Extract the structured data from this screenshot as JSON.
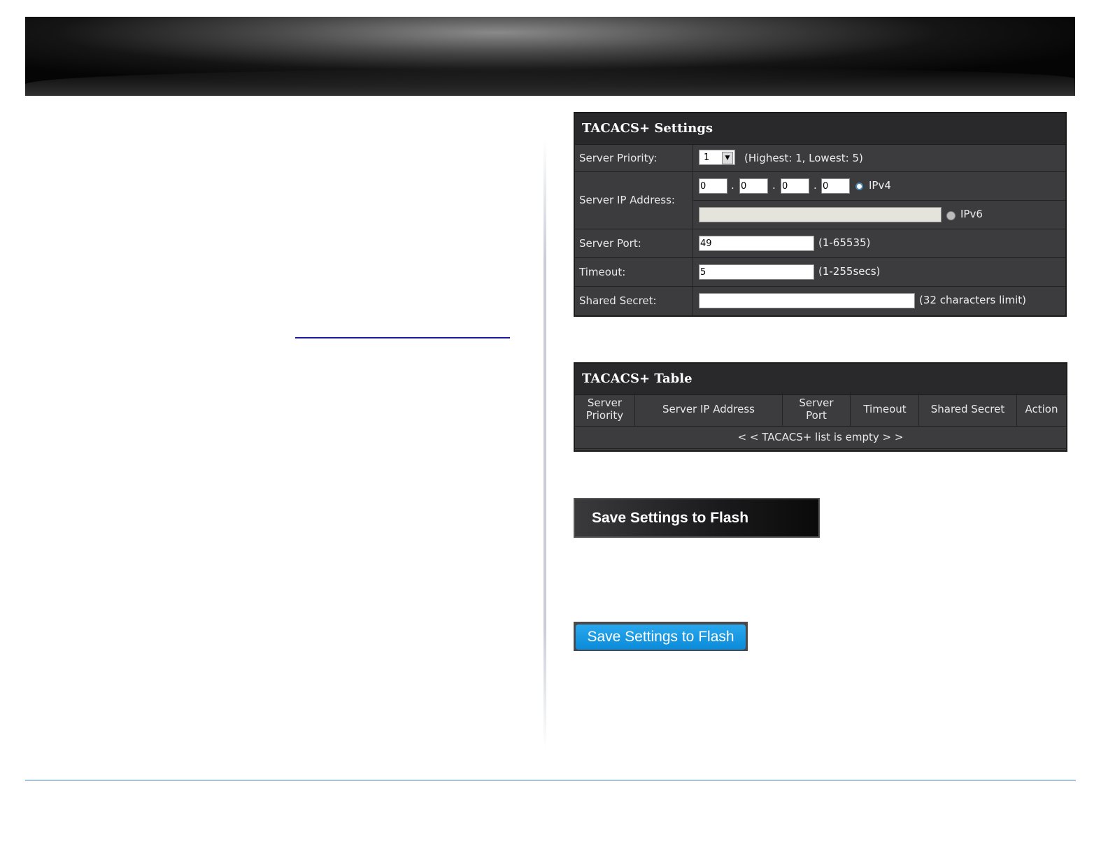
{
  "settings": {
    "title": "TACACS+ Settings",
    "priority_label": "Server Priority:",
    "priority_value": "1",
    "priority_note": "(Highest: 1, Lowest: 5)",
    "ip_label": "Server IP Address:",
    "ip_octets": [
      "0",
      "0",
      "0",
      "0"
    ],
    "ipv4_label": "IPv4",
    "ipv6_label": "IPv6",
    "ipv6_value": "",
    "ip_mode": "IPv4",
    "port_label": "Server Port:",
    "port_value": "49",
    "port_note": "(1-65535)",
    "timeout_label": "Timeout:",
    "timeout_value": "5",
    "timeout_note": "(1-255secs)",
    "secret_label": "Shared Secret:",
    "secret_value": "",
    "secret_note": "(32 characters limit)"
  },
  "table": {
    "title": "TACACS+ Table",
    "columns": [
      "Server Priority",
      "Server IP Address",
      "Server Port",
      "Timeout",
      "Shared Secret",
      "Action"
    ],
    "empty_text": "< < TACACS+ list is empty > >"
  },
  "buttons": {
    "save_dark": "Save Settings to Flash",
    "save_blue": "Save Settings to Flash"
  },
  "colors": {
    "footer_line": "#3a7fd0",
    "link": "#1a1aa0",
    "button_blue": "#1a9ae2"
  }
}
